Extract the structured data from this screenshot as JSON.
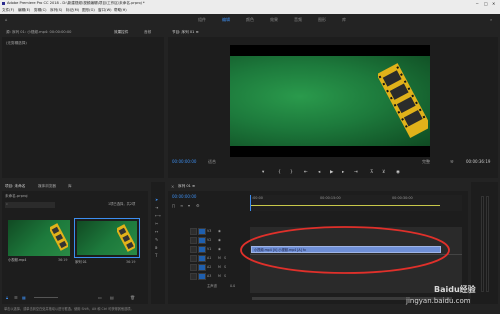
{
  "window": {
    "app_title": "Adobe Premiere Pro CC 2018 - D:\\新建视频\\视频编辑\\项目\\工作区\\未命名.prproj *",
    "controls": [
      "─",
      "□",
      "✕"
    ]
  },
  "menu": [
    "文件(F)",
    "编辑(E)",
    "剪辑(C)",
    "序列(S)",
    "标记(M)",
    "图形(G)",
    "窗口(W)",
    "帮助(H)"
  ],
  "workspace_tabs": [
    {
      "label": "组件",
      "active": false
    },
    {
      "label": "编辑",
      "active": true
    },
    {
      "label": "颜色",
      "active": false
    },
    {
      "label": "效果",
      "active": false
    },
    {
      "label": "音频",
      "active": false
    },
    {
      "label": "图形",
      "active": false
    },
    {
      "label": "库",
      "active": false
    }
  ],
  "source_panel": {
    "tabs": [
      {
        "label": "源: 序列 01: 小视频.mp4: 00:00:00:00",
        "active": false
      },
      {
        "label": "效果控件",
        "active": true
      },
      {
        "label": "音频",
        "active": false
      }
    ],
    "empty_text": "(无剪辑选择)"
  },
  "program_panel": {
    "title": "节目: 序列 01 ≡",
    "current_time": "00:00:00:00",
    "fit_label": "适合",
    "quality_label": "完整",
    "duration": "00:00:36:19",
    "wrench_icon": "wrench-icon"
  },
  "project_panel": {
    "tabs": [
      {
        "label": "项目: 未命名",
        "active": true
      },
      {
        "label": "媒体浏览器",
        "active": false
      },
      {
        "label": "库",
        "active": false
      }
    ],
    "project_file": "未命名.prproj",
    "item_count": "1项已选择，共2项",
    "clips": [
      {
        "name": "小视频.mp4",
        "duration": "36:19"
      },
      {
        "name": "序列 01",
        "duration": "36:19"
      }
    ]
  },
  "timeline_panel": {
    "title": "序列 01 ≡",
    "current_time": "00:00:00:00",
    "ruler_labels": [
      ":00:00",
      "00:00:15:00",
      "00:00:30:00"
    ],
    "tracks": [
      {
        "label": "V3",
        "toggle": "V1"
      },
      {
        "label": "V2",
        "toggle": ""
      },
      {
        "label": "V1",
        "toggle": ""
      },
      {
        "label": "A1",
        "toggle": "A1"
      },
      {
        "label": "A2",
        "toggle": ""
      },
      {
        "label": "A3",
        "toggle": ""
      },
      {
        "label": "主声道",
        "toggle": ""
      }
    ],
    "master_value": "0.0",
    "clip_label": "小视频.mp4 [V] 小视频.mp4 [A] fx"
  },
  "status_bar": {
    "text": "单击以选择，或单击到空白处并拖动以进行框选。使用 Shift、Alt 和 Ctrl 可获得其他选项。"
  },
  "watermark": {
    "line1": "Baidu经验",
    "line2": "jingyan.baidu.com"
  },
  "colors": {
    "accent": "#3d8ef0",
    "clip_fill": "#6f8fd6",
    "annotation_ring": "#e0302a",
    "video_green": "#1d7a3c"
  }
}
